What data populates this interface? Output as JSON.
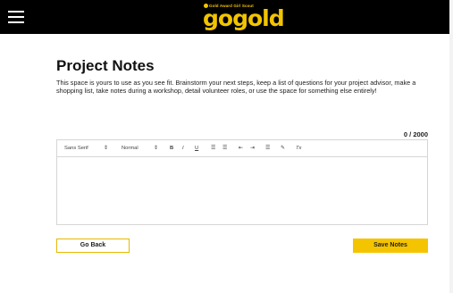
{
  "header": {
    "menu_icon": "hamburger-menu-icon",
    "logo_tagline": "Gold Award Girl Scout",
    "logo_wordmark": "gogold",
    "brand_color": "#f2c400",
    "bar_color": "#000000"
  },
  "main": {
    "title": "Project Notes",
    "description": "This space is yours to use as you see fit. Brainstorm your next steps, keep a list of questions for your project advisor, make a shopping list, take notes during a workshop, detail volunteer roles, or use the space for something else entirely!",
    "char_counter": "0 / 2000",
    "editor": {
      "font_select": "Sans Serif",
      "font_arrow": "⇕",
      "size_select": "Normal",
      "size_arrow": "⇕",
      "bold": "B",
      "italic": "I",
      "underline": "U",
      "ordered_list": "☰",
      "bullet_list": "☰",
      "indent_out": "⇤",
      "indent_in": "⇥",
      "align": "☰",
      "link": "✎",
      "clear_format": "Tx",
      "content": ""
    }
  },
  "actions": {
    "back_label": "Go Back",
    "save_label": "Save Notes"
  }
}
